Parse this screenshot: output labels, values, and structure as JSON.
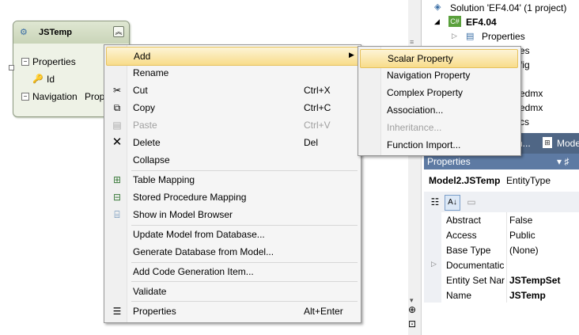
{
  "entity": {
    "title": "JSTemp",
    "properties_label": "Properties",
    "key_property": "Id",
    "navigation_label": "Navigation",
    "navigation_value_partial": "Prop"
  },
  "solution": {
    "title": "Solution 'EF4.04' (1 project)",
    "project": "EF4.04",
    "properties": "Properties",
    "partial_items": [
      "es",
      "fig",
      "edmx",
      "edmx",
      "cs"
    ]
  },
  "tabs": {
    "partial": "n...",
    "model_browser": "Mode"
  },
  "properties_panel": {
    "title": "Properties",
    "pin": "▾ ♯",
    "selected_name": "Model2.JSTemp",
    "selected_type": "EntityType",
    "rows": [
      {
        "name": "Abstract",
        "value": "False"
      },
      {
        "name": "Access",
        "value": "Public"
      },
      {
        "name": "Base Type",
        "value": "(None)"
      },
      {
        "name": "Documentatic",
        "value": ""
      },
      {
        "name": "Entity Set Nar",
        "value": "JSTempSet"
      },
      {
        "name": "Name",
        "value": "JSTemp"
      }
    ]
  },
  "context_menu": {
    "add": "Add",
    "rename": "Rename",
    "cut": "Cut",
    "cut_sc": "Ctrl+X",
    "copy": "Copy",
    "copy_sc": "Ctrl+C",
    "paste": "Paste",
    "paste_sc": "Ctrl+V",
    "delete": "Delete",
    "delete_sc": "Del",
    "collapse": "Collapse",
    "table_mapping": "Table Mapping",
    "sp_mapping": "Stored Procedure Mapping",
    "show_browser": "Show in Model Browser",
    "update_model": "Update Model from Database...",
    "generate_db": "Generate Database from Model...",
    "add_codegen": "Add Code Generation Item...",
    "validate": "Validate",
    "properties": "Properties",
    "properties_sc": "Alt+Enter"
  },
  "submenu": {
    "scalar": "Scalar Property",
    "navigation": "Navigation Property",
    "complex": "Complex Property",
    "association": "Association...",
    "inheritance": "Inheritance...",
    "function_import": "Function Import..."
  },
  "colors": {
    "highlight": "#f8dc8a",
    "panel_title": "#5d7aa3",
    "entity_header": "#c9d4b8"
  }
}
